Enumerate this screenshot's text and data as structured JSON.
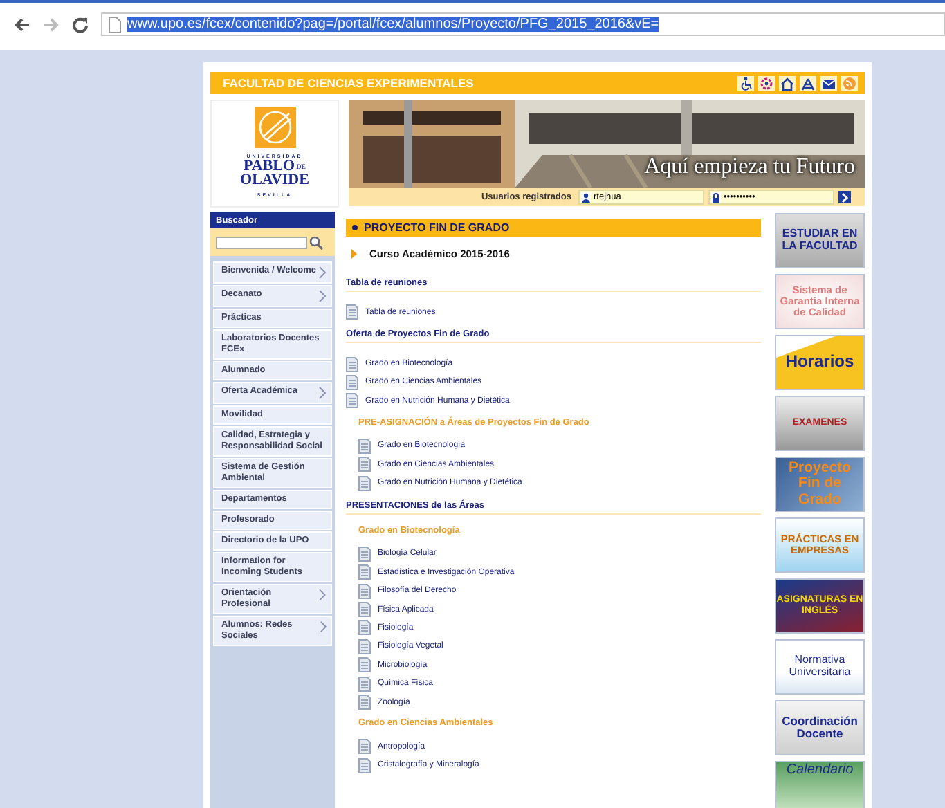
{
  "browser": {
    "url": "www.upo.es/fcex/contenido?pag=/portal/fcex/alumnos/Proyecto/PFG_2015_2016&vE=",
    "selected": true
  },
  "header": {
    "title": "FACULTAD DE CIENCIAS EXPERIMENTALES"
  },
  "logo": {
    "top": "UNIVERSIDAD",
    "name1": "PABLO",
    "de": "DE",
    "name2": "OLAVIDE",
    "city": "SEVILLA"
  },
  "banner": {
    "slogan": "Aquí empieza tu Futuro"
  },
  "login": {
    "label": "Usuarios registrados",
    "user": "rtejhua",
    "password": "••••••••••"
  },
  "search": {
    "title": "Buscador"
  },
  "menu": [
    {
      "label": "Bienvenida / Welcome",
      "submenu": true
    },
    {
      "label": "Decanato",
      "submenu": true
    },
    {
      "label": "Prácticas",
      "submenu": false
    },
    {
      "label": "Laboratorios Docentes FCEx",
      "submenu": false
    },
    {
      "label": "Alumnado",
      "submenu": false
    },
    {
      "label": "Oferta Académica",
      "submenu": true
    },
    {
      "label": "Movilidad",
      "submenu": false
    },
    {
      "label": "Calidad, Estrategia y Responsabilidad Social",
      "submenu": false
    },
    {
      "label": "Sistema de Gestión Ambiental",
      "submenu": false
    },
    {
      "label": "Departamentos",
      "submenu": false
    },
    {
      "label": "Profesorado",
      "submenu": false
    },
    {
      "label": "Directorio de la UPO",
      "submenu": false
    },
    {
      "label": "Information for Incoming Students",
      "submenu": false
    },
    {
      "label": "Orientación Profesional",
      "submenu": true
    },
    {
      "label": "Alumnos: Redes Sociales",
      "submenu": true
    }
  ],
  "content": {
    "title": "PROYECTO FIN DE GRADO",
    "course": "Curso Académico 2015-2016",
    "blocks": [
      {
        "kind": "section",
        "text": "Tabla de reuniones"
      },
      {
        "kind": "link",
        "text": "Tabla de reuniones"
      },
      {
        "kind": "section",
        "text": "Oferta de Proyectos Fin de Grado"
      },
      {
        "kind": "link",
        "text": "Grado en Biotecnología"
      },
      {
        "kind": "link",
        "text": "Grado en Ciencias Ambientales"
      },
      {
        "kind": "link",
        "text": "Grado en Nutrición Humana y Dietética"
      },
      {
        "kind": "subsection",
        "text": "PRE-ASIGNACIÓN a Áreas de Proyectos Fin de Grado"
      },
      {
        "kind": "sublink",
        "text": "Grado en Biotecnología"
      },
      {
        "kind": "sublink",
        "text": "Grado en Ciencias Ambientales"
      },
      {
        "kind": "sublink",
        "text": "Grado en Nutrición Humana y Dietética"
      },
      {
        "kind": "section",
        "text": "PRESENTACIONES de las Áreas"
      },
      {
        "kind": "subsection",
        "text": "Grado en Biotecnología"
      },
      {
        "kind": "sublink",
        "text": "Biología Celular"
      },
      {
        "kind": "sublink",
        "text": "Estadística e Investigación Operativa"
      },
      {
        "kind": "sublink",
        "text": "Filosofía del Derecho"
      },
      {
        "kind": "sublink",
        "text": "Física Aplicada"
      },
      {
        "kind": "sublink",
        "text": "Fisiología"
      },
      {
        "kind": "sublink",
        "text": "Fisiología Vegetal"
      },
      {
        "kind": "sublink",
        "text": "Microbiología"
      },
      {
        "kind": "sublink",
        "text": "Química Física"
      },
      {
        "kind": "sublink",
        "text": "Zoología"
      },
      {
        "kind": "subsection",
        "text": "Grado en Ciencias Ambientales"
      },
      {
        "kind": "sublink",
        "text": "Antropología"
      },
      {
        "kind": "sublink",
        "text": "Cristalografía y Mineralogía"
      }
    ]
  },
  "side_banners": [
    {
      "kind": "gray",
      "text": "ESTUDIAR EN LA FACULTAD"
    },
    {
      "kind": "pink",
      "text": "Sistema de Garantía Interna de Calidad"
    },
    {
      "kind": "yellow",
      "text": "Horarios"
    },
    {
      "kind": "exam",
      "text": "EXAMENES"
    },
    {
      "kind": "blue",
      "text": "Proyecto Fin de Grado"
    },
    {
      "kind": "people",
      "text": "PRÁCTICAS EN EMPRESAS"
    },
    {
      "kind": "flag",
      "text": "ASIGNATURAS EN INGLÉS"
    },
    {
      "kind": "book",
      "text": "Normativa Universitaria"
    },
    {
      "kind": "grid",
      "text": "Coordinación Docente"
    },
    {
      "kind": "calendar",
      "text": "Calendario"
    }
  ]
}
